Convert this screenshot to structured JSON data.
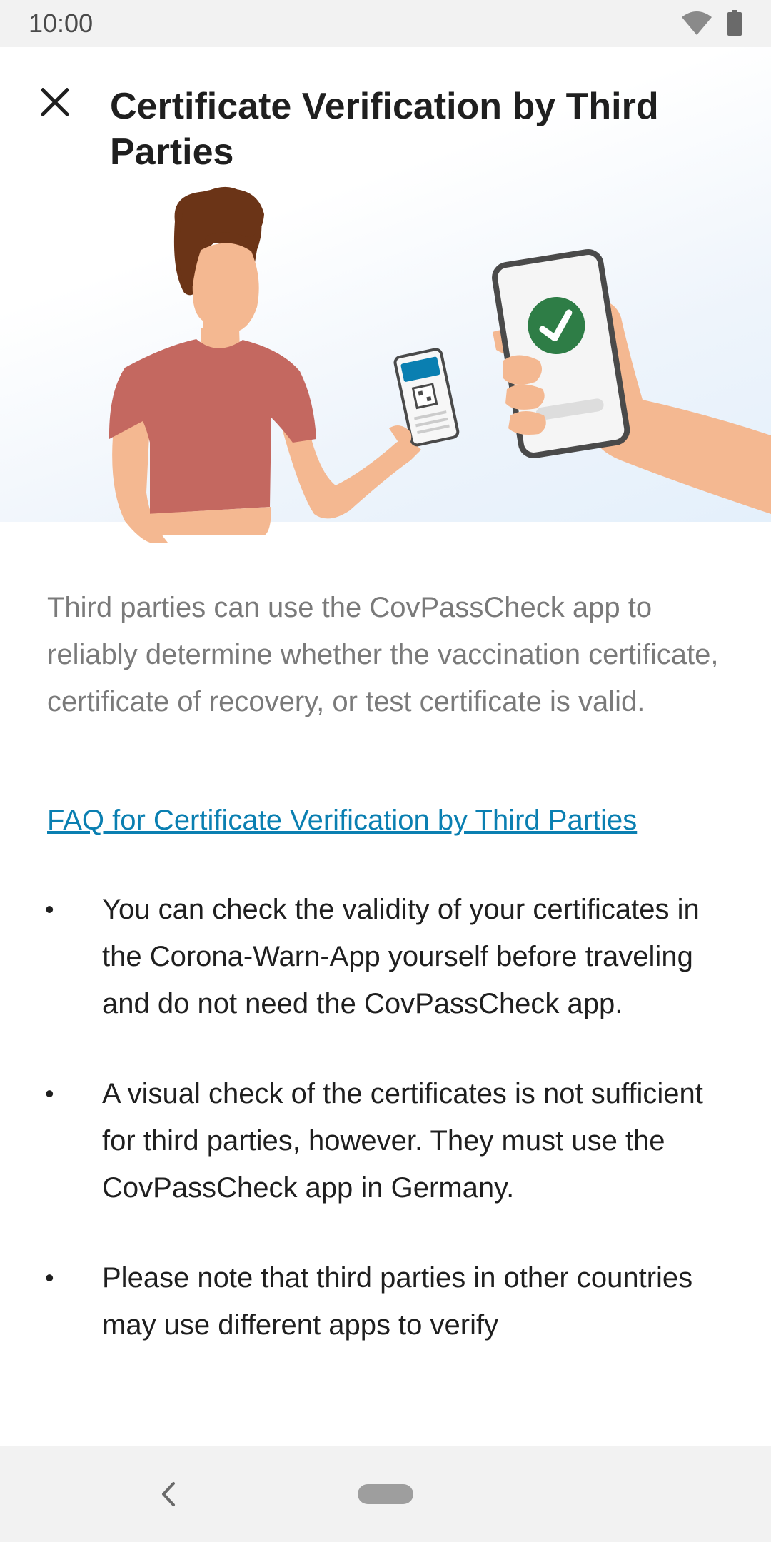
{
  "status_bar": {
    "time": "10:00",
    "icons": [
      "wifi-icon",
      "battery-icon"
    ]
  },
  "header": {
    "close_icon": "close-icon",
    "title": "Certificate Verification by Third Parties"
  },
  "hero": {
    "illustration": "person-showing-certificate-qr-to-verifier-phone-with-checkmark"
  },
  "content": {
    "intro": "Third parties can use the CovPassCheck app to reliably determine whether the vaccination certificate, certificate of recovery, or test certificate is valid.",
    "faq_link": "FAQ for Certificate Verification by Third Parties",
    "bullets": [
      "You can check the validity of your certificates in the Corona-Warn-App yourself before traveling and do not need the CovPassCheck app.",
      "A visual check of the certificates is not sufficient for third parties, however. They must use the CovPassCheck app in Germany.",
      "Please note that third parties in other countries may use different apps to verify"
    ]
  },
  "nav_bar": {
    "icons": [
      "back-chevron-icon",
      "home-pill"
    ]
  },
  "colors": {
    "link": "#0a7fb1",
    "title": "#1f1f1f",
    "intro_text": "#7a7a7a",
    "checkmark_green": "#2e7d46",
    "status_bar_bg": "#f2f2f2"
  }
}
